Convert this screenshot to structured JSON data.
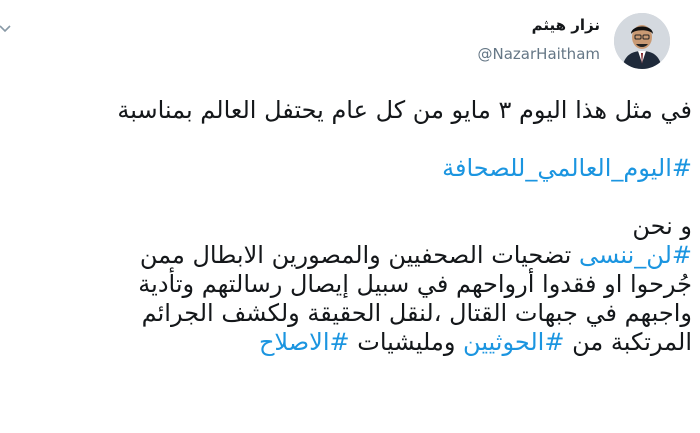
{
  "user": {
    "name": "نزار هيثم",
    "handle": "@NazarHaitham"
  },
  "tweet": {
    "line1": "في مثل هذا اليوم ٣ مايو من كل عام يحتفل العالم بمناسبة",
    "hashtag1": "#اليوم_العالمي_للصحافة",
    "line3": "و نحن",
    "hashtag2": "#لن_ننسى",
    "line4_text": " تضحيات الصحفيين والمصورين الابطال ممن",
    "line5": "جُرحوا او فقدوا أرواحهم في سبيل إيصال رسالتهم وتأدية",
    "line6": "واجبهم في جبهات القتال ،لنقل الحقيقة ولكشف الجرائم",
    "line7_text1": "المرتكبة من  ",
    "hashtag3": "#الحوثيين",
    "line7_text2": " ومليشيات ",
    "hashtag4": "#الاصلاح"
  },
  "icons": {
    "menu": "chevron-down-icon",
    "avatar": "profile-photo"
  },
  "colors": {
    "text": "#14171a",
    "handle": "#657786",
    "hashtag": "#1b95e0"
  }
}
